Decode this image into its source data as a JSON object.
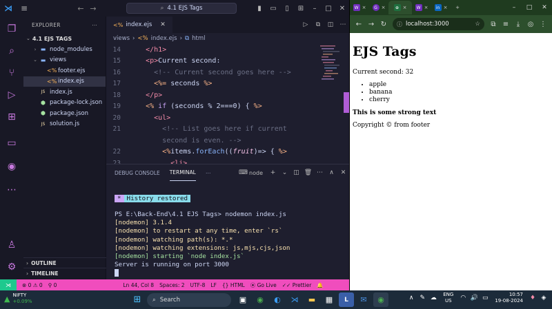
{
  "vscode": {
    "search_text": "4.1 EJS Tags",
    "explorer_label": "EXPLORER",
    "folder_name": "4.1 EJS TAGS",
    "tree": [
      {
        "label": "node_modules",
        "kind": "folder",
        "chev": "›",
        "icon": "folder-icon"
      },
      {
        "label": "views",
        "kind": "folder",
        "chev": "⌄",
        "icon": "folder-icon"
      },
      {
        "label": "footer.ejs",
        "kind": "ejs",
        "chev": "",
        "icon": "ejs-icon"
      },
      {
        "label": "index.ejs",
        "kind": "ejs",
        "chev": "",
        "icon": "ejs-icon"
      },
      {
        "label": "index.js",
        "kind": "js",
        "chev": "",
        "icon": "js-icon"
      },
      {
        "label": "package-lock.json",
        "kind": "json",
        "chev": "",
        "icon": "node-icon"
      },
      {
        "label": "package.json",
        "kind": "json",
        "chev": "",
        "icon": "node-icon"
      },
      {
        "label": "solution.js",
        "kind": "js",
        "chev": "",
        "icon": "js-icon"
      }
    ],
    "outline_label": "OUTLINE",
    "timeline_label": "TIMELINE",
    "tab_label": "index.ejs",
    "breadcrumb": [
      "views",
      "›",
      "index.ejs",
      "›",
      "html"
    ],
    "code_lines": [
      {
        "n": "14",
        "html": "    <span class='tag'>&lt;/h1&gt;</span>"
      },
      {
        "n": "15",
        "html": "    <span class='tag'>&lt;p&gt;</span><span class='txt'>Current second:</span>"
      },
      {
        "n": "16",
        "html": "      <span class='cm'>&lt;!-- Current second goes here --&gt;</span>"
      },
      {
        "n": "17",
        "html": "      <span class='ejs'>&lt;%=</span><span class='txt'> seconds </span><span class='ejs'>%&gt;</span>"
      },
      {
        "n": "18",
        "html": "    <span class='tag'>&lt;/p&gt;</span>"
      },
      {
        "n": "19",
        "html": "    <span class='ejs'>&lt;%</span> <span class='kw'>if</span> <span class='txt'>(seconds % 2===0) {</span> <span class='ejs'>%&gt;</span>"
      },
      {
        "n": "20",
        "html": "      <span class='tag'>&lt;ul&gt;</span>"
      },
      {
        "n": "21",
        "html": "        <span class='cm'>&lt;!-- List goes here if current</span>"
      },
      {
        "n": "",
        "html": "        <span class='cm'>second is even. --&gt;</span>"
      },
      {
        "n": "22",
        "html": "        <span class='ejs'>&lt;%</span><span class='txt'>items.</span><span class='fn'>forEach</span><span class='txt'>((</span><span class='pm'>fruit</span><span class='txt'>)=&gt; {</span> <span class='ejs'>%&gt;</span>"
      },
      {
        "n": "23",
        "html": "          <span class='tag'>&lt;li&gt;</span>"
      }
    ],
    "panel_tabs": [
      "DEBUG CONSOLE",
      "TERMINAL"
    ],
    "terminal_profile": "node",
    "history_label": "History restored",
    "terminal_lines": [
      {
        "cls": "white",
        "text": "PS E:\\Back-End\\4.1 EJS Tags> nodemon index.js"
      },
      {
        "cls": "yellow",
        "text": "[nodemon] 3.1.4"
      },
      {
        "cls": "yellow",
        "text": "[nodemon] to restart at any time, enter `rs`"
      },
      {
        "cls": "yellow",
        "text": "[nodemon] watching path(s): *.*"
      },
      {
        "cls": "yellow",
        "text": "[nodemon] watching extensions: js,mjs,cjs,json"
      },
      {
        "cls": "green",
        "text": "[nodemon] starting `node index.js`"
      },
      {
        "cls": "white",
        "text": "Server is running on port 3000"
      }
    ],
    "status": {
      "problems": "⊗ 0 ⚠ 0",
      "ports": "⚲ 0",
      "position": "Ln 44, Col 8",
      "spaces": "Spaces: 2",
      "encoding": "UTF-8",
      "eol": "LF",
      "language": "HTML",
      "golive": "Go Live",
      "prettier": "Prettier"
    }
  },
  "browser": {
    "url": "localhost:3000",
    "page": {
      "heading": "EJS Tags",
      "current_second": "Current second: 32",
      "items": [
        "apple",
        "banana",
        "cherry"
      ],
      "strong": "This is some strong text",
      "footer": "Copyright © from footer"
    }
  },
  "taskbar": {
    "nifty_label": "NIFTY",
    "nifty_change": "+0.09%",
    "search_label": "Search",
    "lang_top": "ENG",
    "lang_bottom": "US",
    "time": "10:57",
    "date": "19-08-2024"
  },
  "colors": {
    "statusbar": "#f04dbd",
    "accent": "#cba6f7",
    "browser_chrome": "#2d4f2d"
  }
}
